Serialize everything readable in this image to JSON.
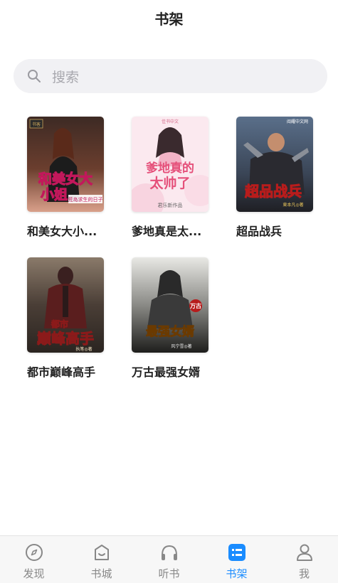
{
  "header": {
    "title": "书架"
  },
  "search": {
    "placeholder": "搜索"
  },
  "books": [
    {
      "name": "和美女大小...",
      "cover_title_1": "和美女大",
      "cover_title_2": "小姐",
      "cover_subtitle": "荒岛求生的日子",
      "badge": "书客"
    },
    {
      "name": "爹地真是太...",
      "cover_title_1": "爹地真的",
      "cover_title_2": "太帅了",
      "cover_subtitle": "君乐新作品",
      "badge": "佳书中文"
    },
    {
      "name": "超品战兵",
      "cover_title_1": "超品战兵",
      "cover_subtitle": "東本凡◎著",
      "badge": "阅耀中文网"
    },
    {
      "name": "都市巅峰高手",
      "cover_title_1": "都市",
      "cover_title_2": "巅峰高手",
      "cover_subtitle": "执笔◎著"
    },
    {
      "name": "万古最强女婿",
      "cover_title_1": "万古",
      "cover_title_2": "最强女婿",
      "cover_subtitle": "风宁雪◎著"
    }
  ],
  "tabbar": {
    "tabs": [
      {
        "label": "发现",
        "icon": "compass-icon"
      },
      {
        "label": "书城",
        "icon": "store-bag-icon"
      },
      {
        "label": "听书",
        "icon": "headphones-icon"
      },
      {
        "label": "书架",
        "icon": "bookshelf-list-icon",
        "active": true
      },
      {
        "label": "我",
        "icon": "user-icon"
      }
    ]
  },
  "colors": {
    "accent": "#1a8cff",
    "inactive": "#888888",
    "search_bg": "#f1f1f4"
  }
}
